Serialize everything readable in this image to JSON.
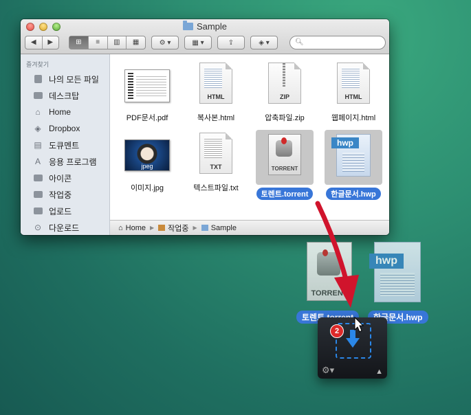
{
  "window": {
    "title": "Sample"
  },
  "toolbar": {
    "back": "◀",
    "forward": "▶",
    "view_icon": "⊞",
    "view_list": "≡",
    "view_column": "▥",
    "view_coverflow": "▦",
    "action": "⚙",
    "arrange": "▦",
    "share": "⇪",
    "dropbox": "◈",
    "search_placeholder": ""
  },
  "sidebar": {
    "header": "즐겨찾기",
    "items": [
      {
        "label": "나의 모든 파일",
        "icon": "all-files-icon"
      },
      {
        "label": "데스크탑",
        "icon": "desktop-icon"
      },
      {
        "label": "Home",
        "icon": "home-icon"
      },
      {
        "label": "Dropbox",
        "icon": "dropbox-icon"
      },
      {
        "label": "도큐멘트",
        "icon": "documents-icon"
      },
      {
        "label": "응용 프로그램",
        "icon": "applications-icon"
      },
      {
        "label": "아이콘",
        "icon": "folder-icon"
      },
      {
        "label": "작업중",
        "icon": "folder-icon"
      },
      {
        "label": "업로드",
        "icon": "folder-icon"
      },
      {
        "label": "다운로드",
        "icon": "downloads-icon"
      }
    ]
  },
  "files": [
    {
      "name": "PDF문서.pdf",
      "kind": "pdf",
      "tag": ""
    },
    {
      "name": "복사본.html",
      "kind": "doc",
      "tag": "HTML"
    },
    {
      "name": "압축파일.zip",
      "kind": "zip",
      "tag": "ZIP"
    },
    {
      "name": "웹페이지.html",
      "kind": "doc",
      "tag": "HTML"
    },
    {
      "name": "이미지.jpg",
      "kind": "jpg",
      "tag": "jpeg"
    },
    {
      "name": "텍스트파일.txt",
      "kind": "doc",
      "tag": "TXT"
    },
    {
      "name": "토렌트.torrent",
      "kind": "torrent",
      "tag": "TORRENT",
      "selected": true
    },
    {
      "name": "한글문서.hwp",
      "kind": "hwp",
      "tag": "hwp",
      "selected": true
    }
  ],
  "pathbar": {
    "items": [
      "Home",
      "작업중",
      "Sample"
    ]
  },
  "drag": {
    "torrent_label": "토렌트.torrent",
    "hwp_label": "한글문서.hwp",
    "torrent_tag": "TORRENT",
    "hwp_tag": "hwp"
  },
  "dock_widget": {
    "badge_count": "2"
  },
  "colors": {
    "selection": "#3876d8",
    "arrow": "#d0142c",
    "dropzone": "#2b87e8"
  }
}
